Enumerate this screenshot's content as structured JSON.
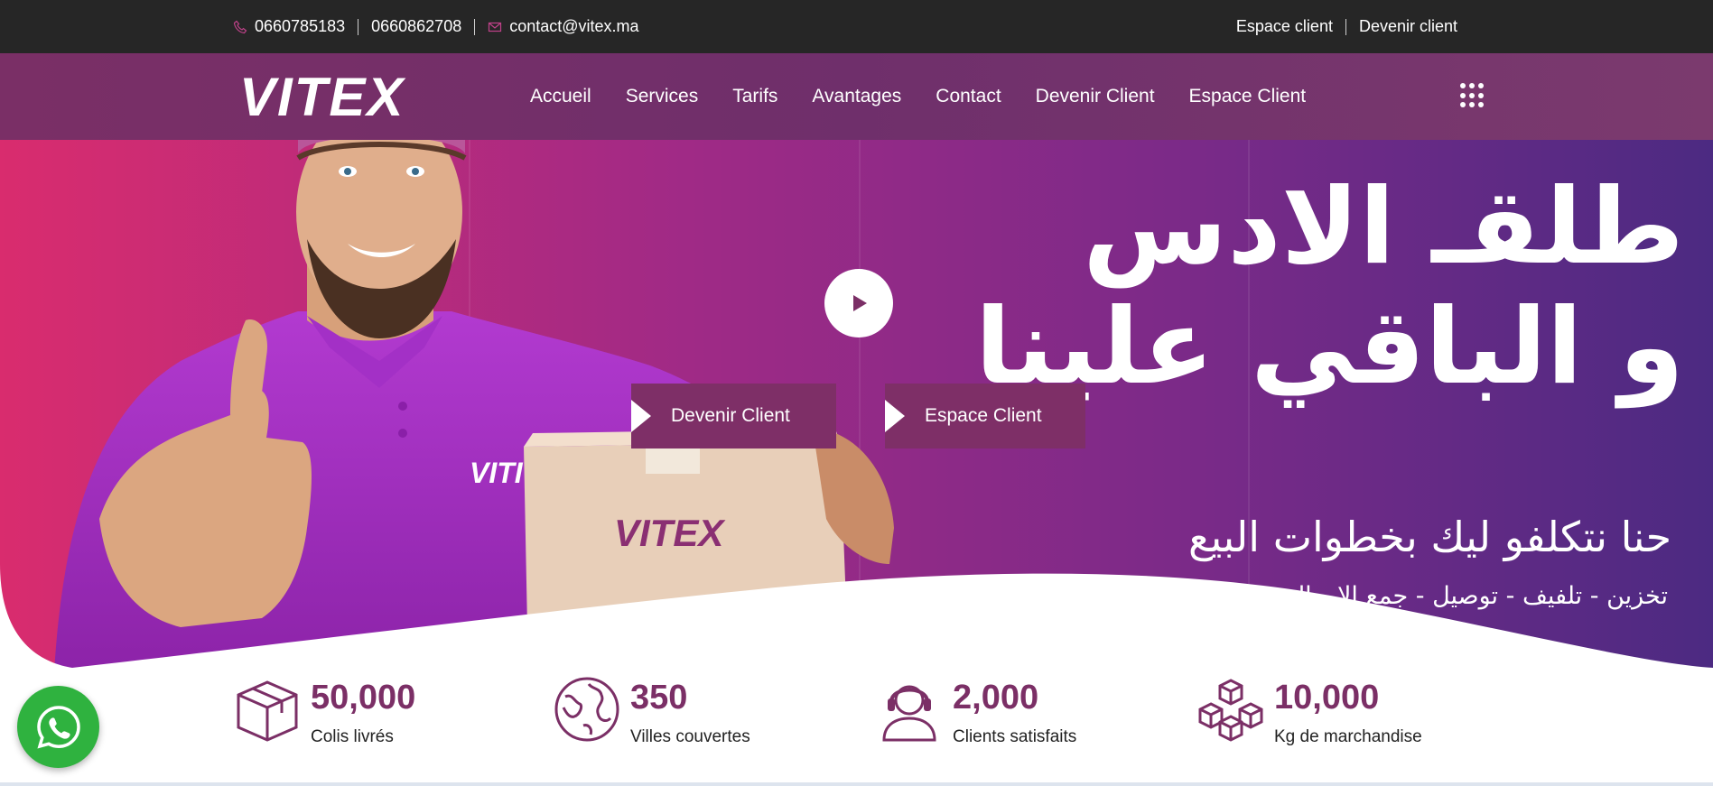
{
  "topbar": {
    "phone1": "0660785183",
    "phone2": "0660862708",
    "email": "contact@vitex.ma",
    "links": [
      "Espace client",
      "Devenir client"
    ]
  },
  "nav": {
    "logo_text": "VITEX",
    "items": [
      "Accueil",
      "Services",
      "Tarifs",
      "Avantages",
      "Contact",
      "Devenir Client",
      "Espace Client"
    ],
    "menu_icon": "grid-dots-icon"
  },
  "hero": {
    "title_line1": "طلقـ الادس",
    "title_line2": "و الباقي علينا",
    "subtitle": "حنا نتكلفو ليك بخطوات البيع",
    "tagline": "تخزين - تلفيف - توصيل - جمع الاموال و إعادتها.",
    "box_logo": "VITEX",
    "shirt_logo": "VITI",
    "buttons": [
      "Devenir Client",
      "Espace Client"
    ],
    "colors": {
      "start": "#d92c6e",
      "mid": "#8a2a86",
      "end": "#4a2a82"
    }
  },
  "stats": [
    {
      "value": "50,000",
      "label": "Colis livrés",
      "icon": "package-icon"
    },
    {
      "value": "350",
      "label": "Villes couvertes",
      "icon": "globe-icon"
    },
    {
      "value": "2,000",
      "label": "Clients satisfaits",
      "icon": "support-agent-icon"
    },
    {
      "value": "10,000",
      "label": "Kg de marchandise",
      "icon": "boxes-icon"
    }
  ],
  "colors": {
    "brand": "#7b2f66",
    "topbar": "#262626",
    "whatsapp": "#2fb23f"
  }
}
